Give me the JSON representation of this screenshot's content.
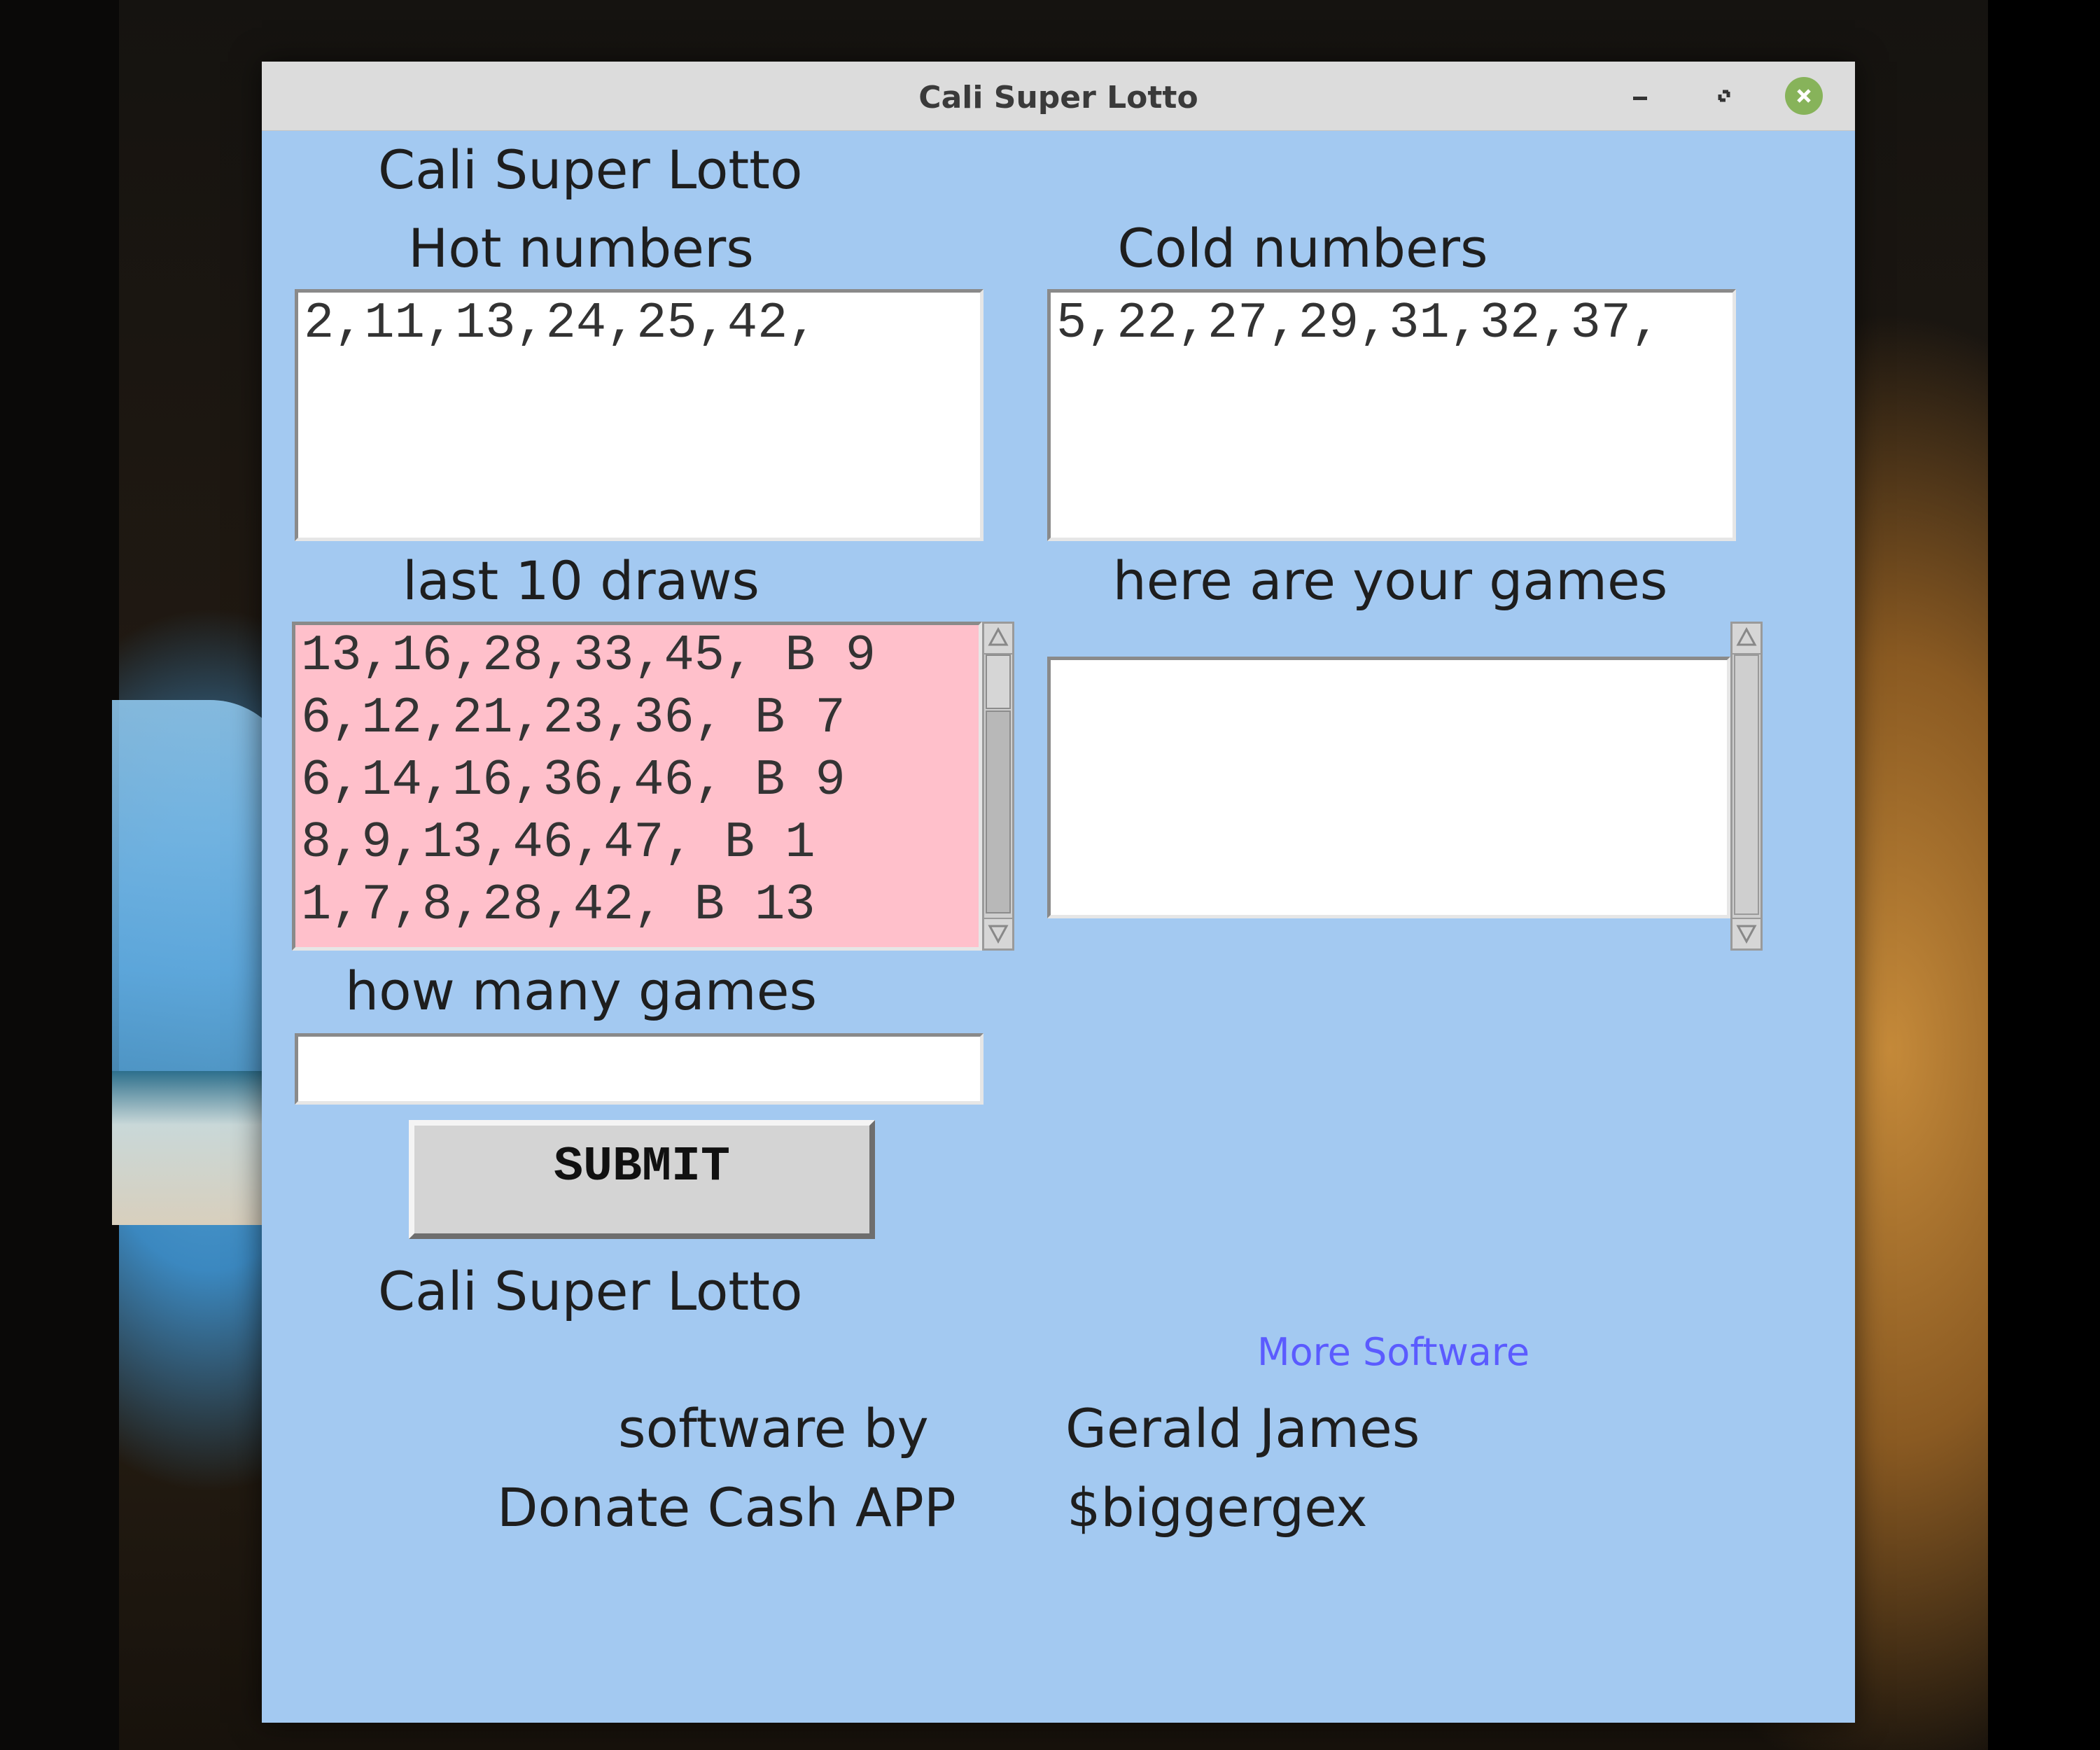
{
  "window": {
    "title": "Cali Super Lotto"
  },
  "app": {
    "heading": "Cali Super Lotto",
    "hot_label": "Hot numbers",
    "hot_value": "2,11,13,24,25,42,",
    "cold_label": "Cold numbers",
    "cold_value": "5,22,27,29,31,32,37,",
    "draws_label": "last 10 draws",
    "draws": [
      "13,16,28,33,45, B 9",
      "6,12,21,23,36, B 7",
      "6,14,16,36,46, B 9",
      "8,9,13,46,47, B 1",
      "1,7,8,28,42, B 13"
    ],
    "games_label": "here are your games",
    "games_value": "",
    "how_many_label": "how many games",
    "how_many_value": "",
    "submit_label": "SUBMIT",
    "footer_title": "Cali Super Lotto",
    "more_software_link": "More Software",
    "software_by_label": "software by",
    "author": "Gerald James",
    "donate_label": "Donate Cash APP",
    "cashtag": "$biggergex"
  },
  "colors": {
    "window_bg": "#a3c9f1",
    "draws_bg": "#ffc0cb",
    "link": "#5b5bff",
    "close_button": "#87b35a"
  }
}
